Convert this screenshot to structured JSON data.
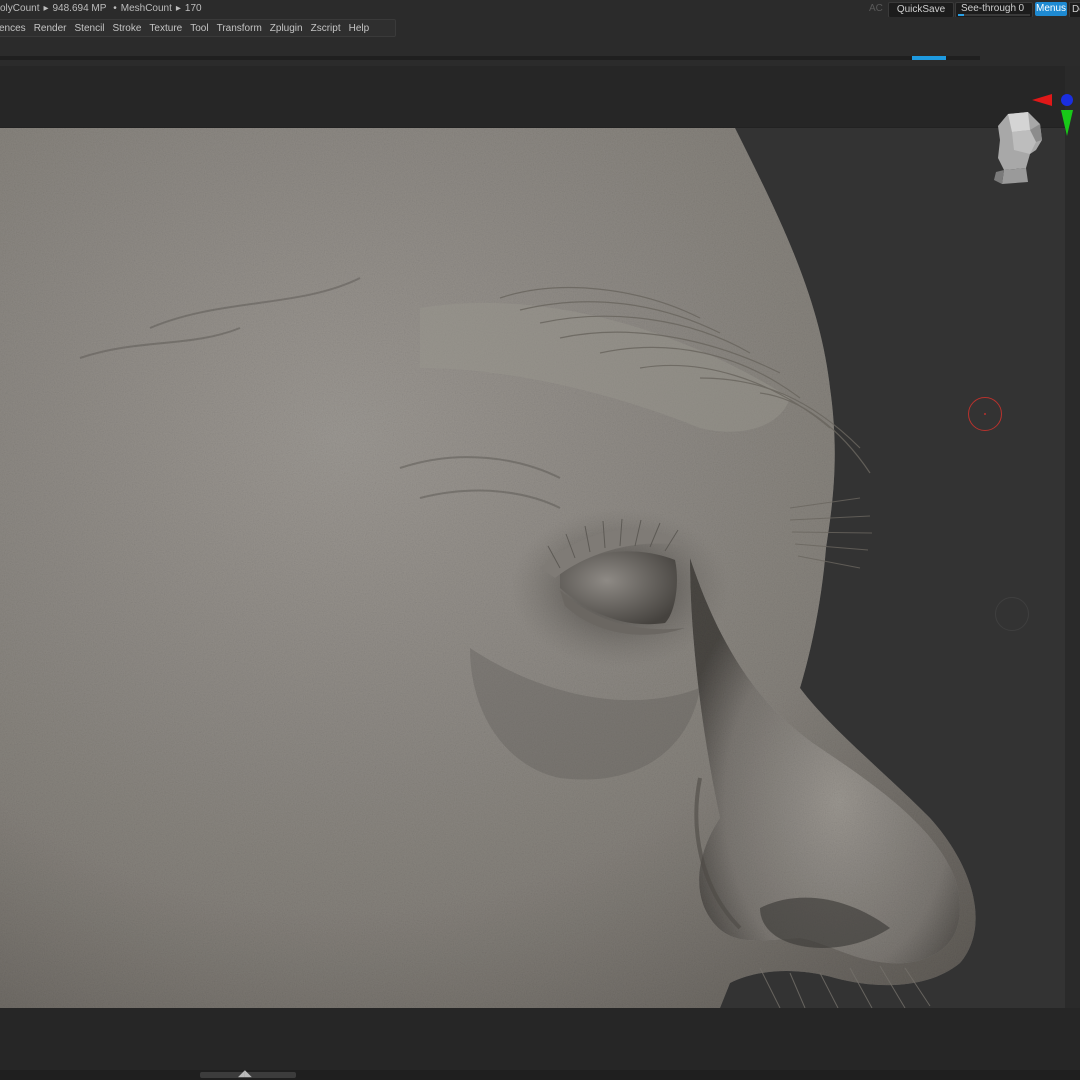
{
  "statusbar": {
    "poly_count_label": "olyCount",
    "poly_count_value": "948.694 MP",
    "mesh_count_label": "MeshCount",
    "mesh_count_value": "170",
    "ac_label": "AC",
    "quicksave_label": "QuickSave",
    "seethrough_label": "See-through",
    "seethrough_value": "0",
    "menus_label": "Menus",
    "default_label": "De"
  },
  "menubar": {
    "items": [
      "ences",
      "Render",
      "Stencil",
      "Stroke",
      "Texture",
      "Tool",
      "Transform",
      "Zplugin",
      "Zscript",
      "Help"
    ]
  },
  "gizmo": {
    "x_color": "#e01818",
    "y_color": "#18c818",
    "z_color": "#1a2ee0"
  },
  "viewport": {
    "background_color": "#333333",
    "mesh_color": "#8a8680"
  },
  "brush": {
    "cursor_color": "#b8322d"
  },
  "icons": {
    "gizmo": "axis-gizmo-icon",
    "head": "head-orientation-icon",
    "bottom": "collapse-arrows-icon"
  }
}
